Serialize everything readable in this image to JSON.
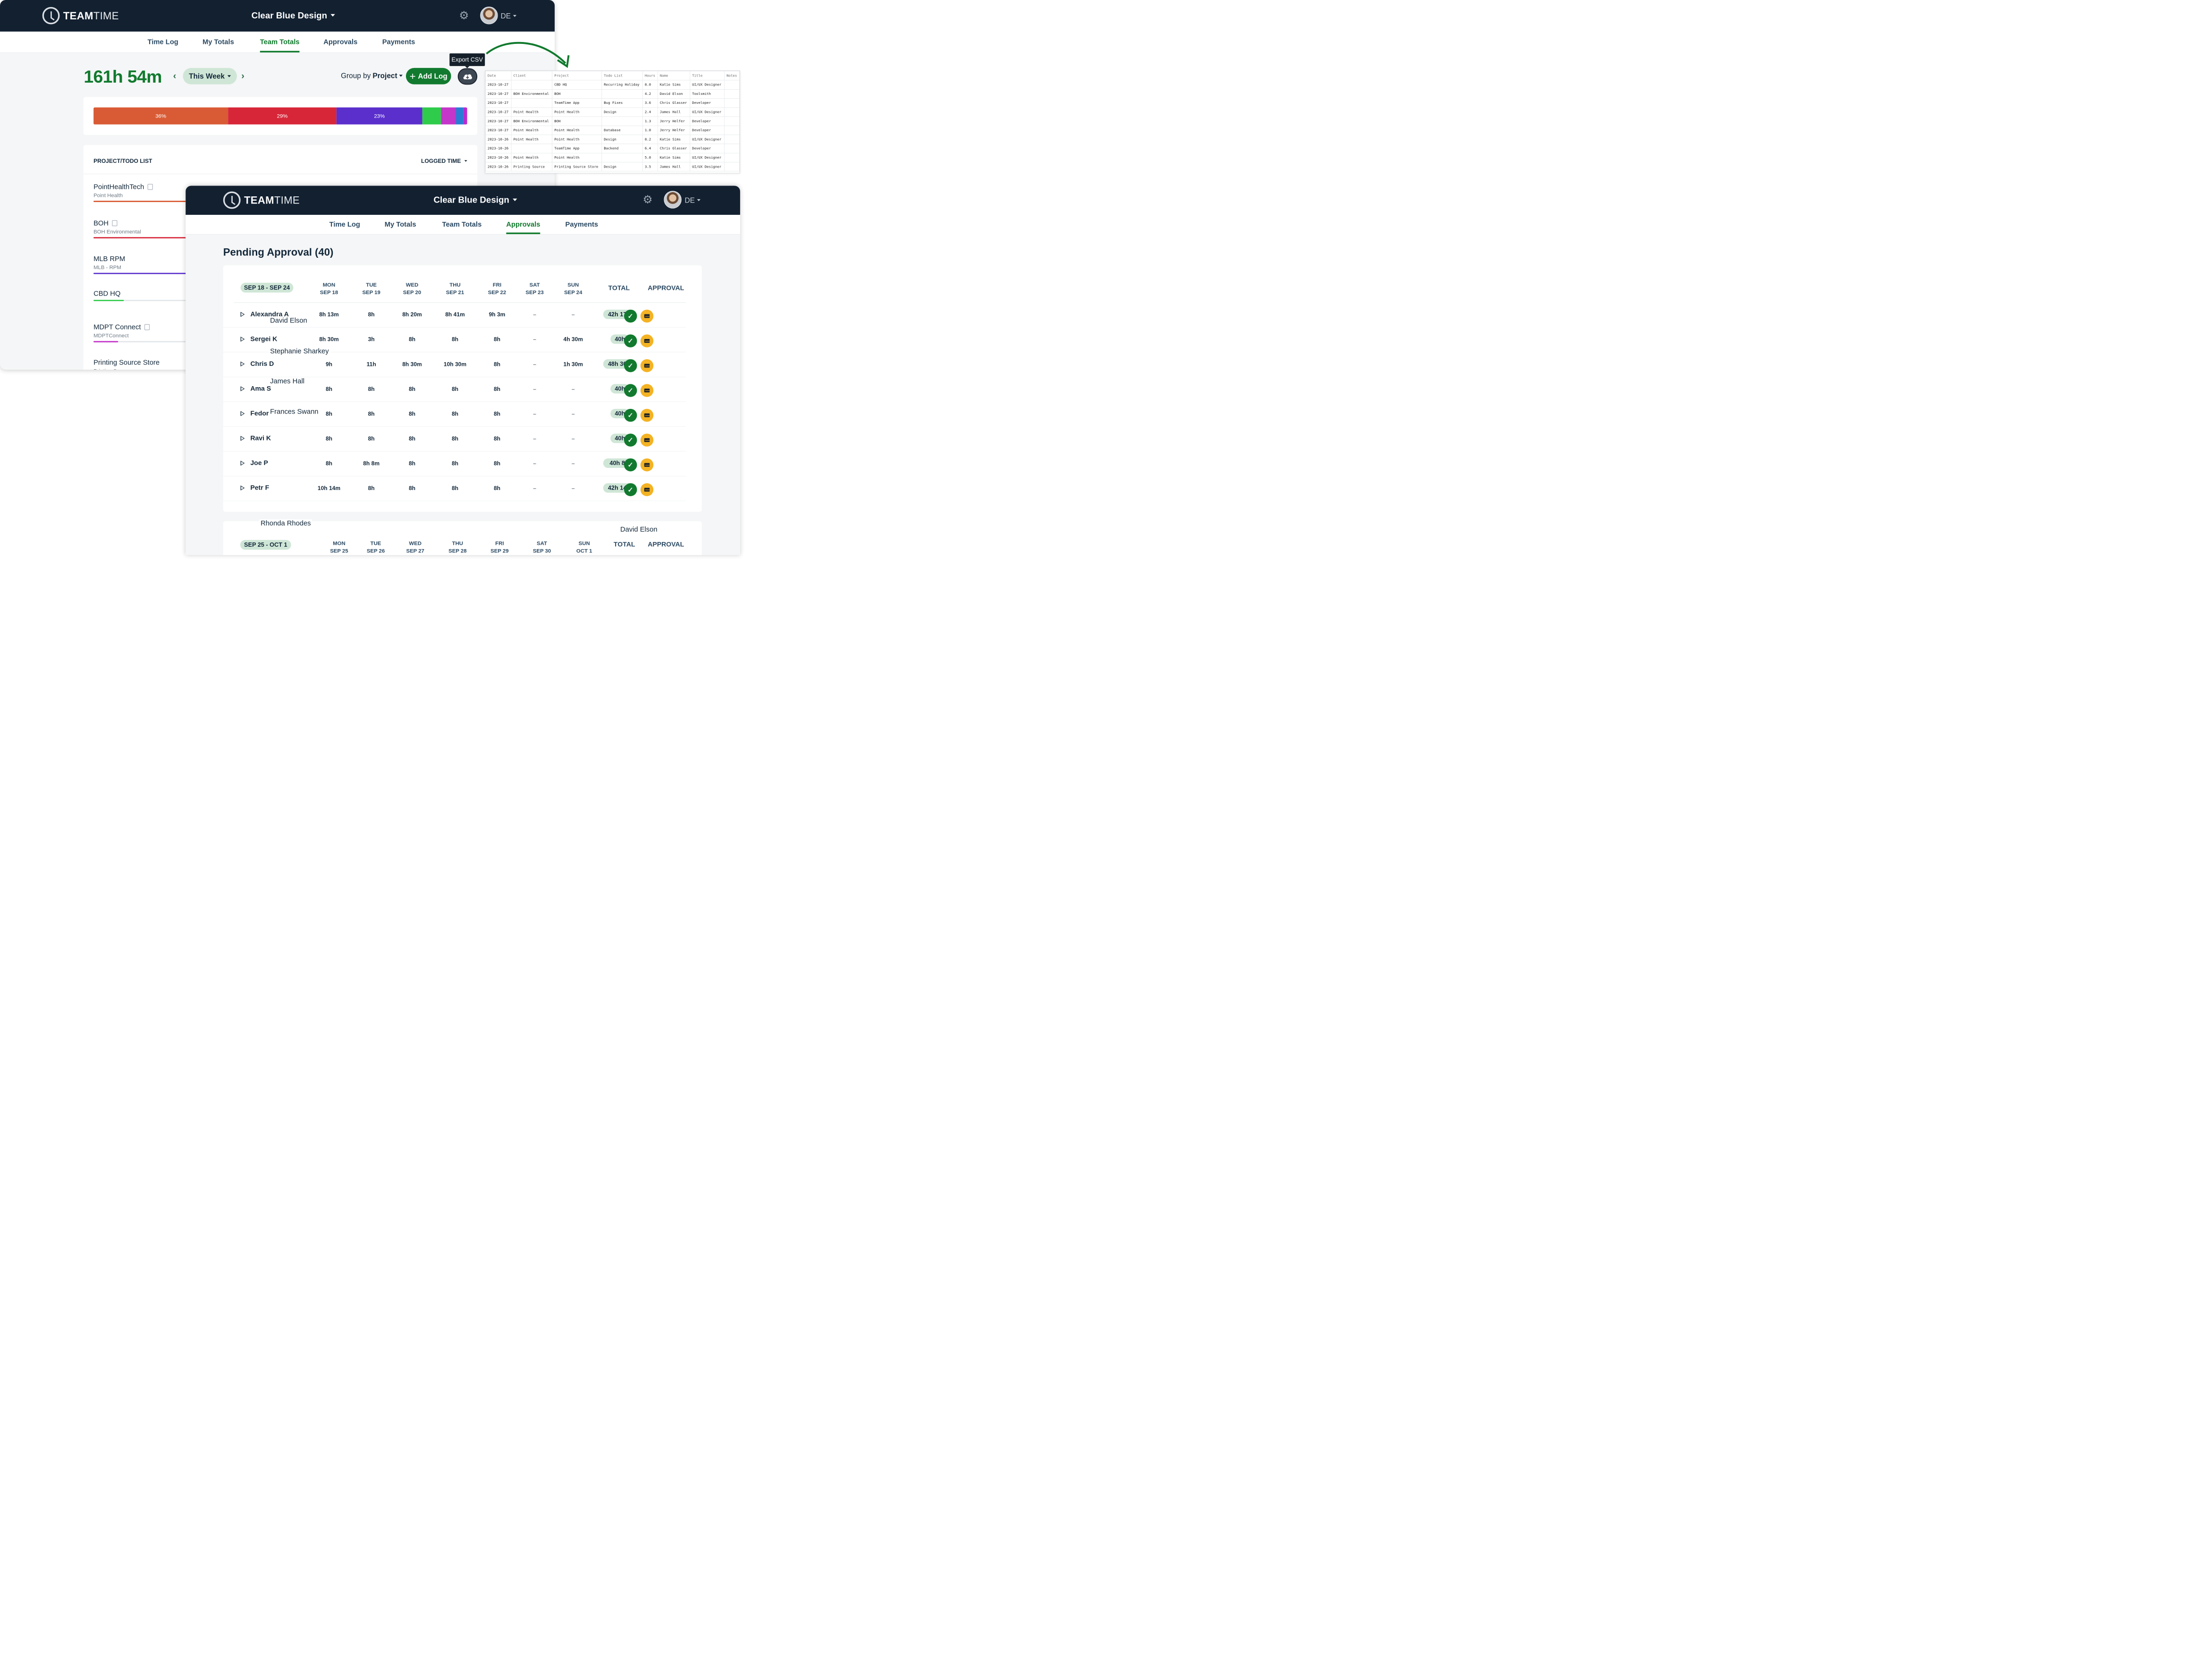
{
  "brand": {
    "strong": "TEAM",
    "light": "TIME"
  },
  "company": "Clear Blue Design",
  "user_initials": "DE",
  "tabs": [
    "Time Log",
    "My Totals",
    "Team Totals",
    "Approvals",
    "Payments"
  ],
  "team_totals": {
    "total": "161h 54m",
    "week": "This Week",
    "group_by_prefix": "Group by",
    "group_by_value": "Project",
    "add_log": "Add Log",
    "export_tooltip": "Export CSV",
    "bar_segments": [
      {
        "label": "36%",
        "value": 36,
        "color": "#d95b35"
      },
      {
        "label": "29%",
        "value": 29,
        "color": "#d72638"
      },
      {
        "label": "23%",
        "value": 23,
        "color": "#5a2fcc"
      },
      {
        "label": "",
        "value": 5,
        "color": "#2ecc4a"
      },
      {
        "label": "",
        "value": 4,
        "color": "#c435c9"
      },
      {
        "label": "",
        "value": 2,
        "color": "#2a7bd4"
      },
      {
        "label": "",
        "value": 1,
        "color": "#b92bd0"
      }
    ],
    "list_header": "PROJECT/TODO LIST",
    "logged_header": "LOGGED TIME",
    "projects": [
      {
        "name": "PointHealthTech",
        "client": "Point Health",
        "note": true,
        "progress": 1.0,
        "color": "#d95b35"
      },
      {
        "name": "BOH",
        "client": "BOH Environmental",
        "note": true,
        "progress": 0.98,
        "color": "#d72638"
      },
      {
        "name": "MLB RPM",
        "client": "MLB - RPM",
        "note": false,
        "progress": 0.75,
        "color": "#5a2fcc"
      },
      {
        "name": "CBD HQ",
        "client": "",
        "note": false,
        "progress": 0.16,
        "color": "#2ecc4a"
      },
      {
        "name": "MDPT Connect",
        "client": "MDPTConnect",
        "note": true,
        "progress": 0.13,
        "color": "#c435c9"
      },
      {
        "name": "Printing Source Store",
        "client": "Printing Source",
        "note": false,
        "progress": 0.0,
        "color": "#2a7bd4"
      }
    ]
  },
  "csv": {
    "headers": [
      "Date",
      "Client",
      "Project",
      "Todo List",
      "Hours",
      "Name",
      "Title",
      "Notes"
    ],
    "rows": [
      [
        "2023-10-27",
        "",
        "CBD HQ",
        "Recurring Holiday",
        "8.0",
        "Katie Sims",
        "UI/UX Designer",
        ""
      ],
      [
        "2023-10-27",
        "BOH Environmental",
        "BOH",
        "",
        "4.2",
        "David Elson",
        "Toolsmith",
        ""
      ],
      [
        "2023-10-27",
        "",
        "TeamTime App",
        "Bug Fixes",
        "3.6",
        "Chris Glasser",
        "Developer",
        ""
      ],
      [
        "2023-10-27",
        "Point Health",
        "Point Health",
        "Design",
        "2.4",
        "James Hall",
        "UI/UX Designer",
        ""
      ],
      [
        "2023-10-27",
        "BOH Environmental",
        "BOH",
        "",
        "1.3",
        "Jerry Helfer",
        "Developer",
        ""
      ],
      [
        "2023-10-27",
        "Point Health",
        "Point Health",
        "Database",
        "1.0",
        "Jerry Helfer",
        "Developer",
        ""
      ],
      [
        "2023-10-26",
        "Point Health",
        "Point Health",
        "Design",
        "8.2",
        "Katie Sims",
        "UI/UX Designer",
        ""
      ],
      [
        "2023-10-26",
        "",
        "TeamTime App",
        "Backend",
        "6.4",
        "Chris Glasser",
        "Developer",
        ""
      ],
      [
        "2023-10-26",
        "Point Health",
        "Point Health",
        "",
        "5.0",
        "Katie Sims",
        "UI/UX Designer",
        ""
      ],
      [
        "2023-10-26",
        "Printing Source",
        "Printing Source Store",
        "Design",
        "3.5",
        "James Hall",
        "UI/UX Designer",
        ""
      ]
    ]
  },
  "approvals": {
    "title": "Pending Approval (40)",
    "week1": {
      "range": "SEP 18 - SEP 24",
      "days": [
        {
          "d": "MON",
          "date": "SEP 18"
        },
        {
          "d": "TUE",
          "date": "SEP 19"
        },
        {
          "d": "WED",
          "date": "SEP 20"
        },
        {
          "d": "THU",
          "date": "SEP 21"
        },
        {
          "d": "FRI",
          "date": "SEP 22"
        },
        {
          "d": "SAT",
          "date": "SEP 23"
        },
        {
          "d": "SUN",
          "date": "SEP 24"
        }
      ],
      "total_label": "TOTAL",
      "approval_label": "APPROVAL",
      "rows": [
        {
          "name": "Alexandra A",
          "hours": [
            "8h 13m",
            "8h",
            "8h 20m",
            "8h 41m",
            "9h 3m",
            "–",
            "–"
          ],
          "total": "42h 17m"
        },
        {
          "name": "Sergei K",
          "hours": [
            "8h 30m",
            "3h",
            "8h",
            "8h",
            "8h",
            "–",
            "4h 30m"
          ],
          "total": "40h"
        },
        {
          "name": "Chris D",
          "hours": [
            "9h",
            "11h",
            "8h 30m",
            "10h 30m",
            "8h",
            "–",
            "1h 30m"
          ],
          "total": "48h 30m"
        },
        {
          "name": "Ama S",
          "hours": [
            "8h",
            "8h",
            "8h",
            "8h",
            "8h",
            "–",
            "–"
          ],
          "total": "40h"
        },
        {
          "name": "Fedor K",
          "hours": [
            "8h",
            "8h",
            "8h",
            "8h",
            "8h",
            "–",
            "–"
          ],
          "total": "40h"
        },
        {
          "name": "Ravi K",
          "hours": [
            "8h",
            "8h",
            "8h",
            "8h",
            "8h",
            "–",
            "–"
          ],
          "total": "40h"
        },
        {
          "name": "Joe P",
          "hours": [
            "8h",
            "8h 8m",
            "8h",
            "8h",
            "8h",
            "–",
            "–"
          ],
          "total": "40h 8m"
        },
        {
          "name": "Petr F",
          "hours": [
            "10h 14m",
            "8h",
            "8h",
            "8h",
            "8h",
            "–",
            "–"
          ],
          "total": "42h 14m"
        }
      ]
    },
    "week2": {
      "range": "SEP 25 - OCT 1",
      "days": [
        {
          "d": "MON",
          "date": "SEP 25"
        },
        {
          "d": "TUE",
          "date": "SEP 26"
        },
        {
          "d": "WED",
          "date": "SEP 27"
        },
        {
          "d": "THU",
          "date": "SEP 28"
        },
        {
          "d": "FRI",
          "date": "SEP 29"
        },
        {
          "d": "SAT",
          "date": "SEP 30"
        },
        {
          "d": "SUN",
          "date": "OCT 1"
        }
      ],
      "total_label": "TOTAL",
      "approval_label": "APPROVAL"
    },
    "overlay_names": [
      "David Elson",
      "Stephanie Sharkey",
      "James Hall",
      "Frances Swann",
      "Rhonda Rhodes",
      "David Elson"
    ]
  },
  "icons": {
    "clock": "clock-logo-icon",
    "gear": "gear-icon",
    "export": "cloud-download-icon",
    "approve": "check-icon",
    "email": "envelope-icon",
    "expand": "expand-triangle-icon"
  }
}
